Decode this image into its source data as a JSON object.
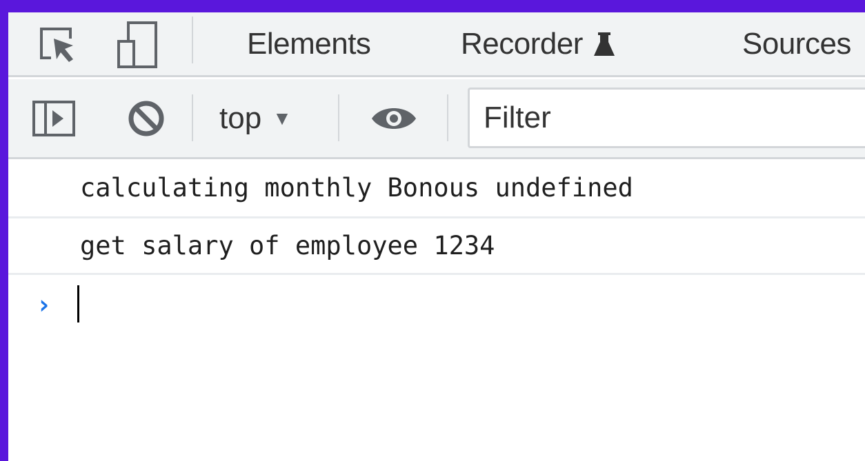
{
  "tabs": [
    {
      "label": "Elements"
    },
    {
      "label": "Recorder",
      "icon": "flask-icon"
    },
    {
      "label": "Sources"
    }
  ],
  "toolbar": {
    "inspect_icon": "inspect-element-icon",
    "device_icon": "device-toolbar-icon",
    "sidebar_icon": "show-sidebar-icon",
    "clear_icon": "clear-console-icon",
    "context": "top",
    "context_caret": "▼",
    "live_expression_icon": "eye-icon",
    "filter_placeholder": "Filter"
  },
  "console": {
    "messages": [
      {
        "text": "calculating monthly Bonous undefined"
      },
      {
        "text": "get salary of employee 1234"
      }
    ],
    "prompt": "›"
  },
  "colors": {
    "background": "#5a17dc",
    "toolbar": "#f1f3f4",
    "prompt_accent": "#1a73e8"
  }
}
